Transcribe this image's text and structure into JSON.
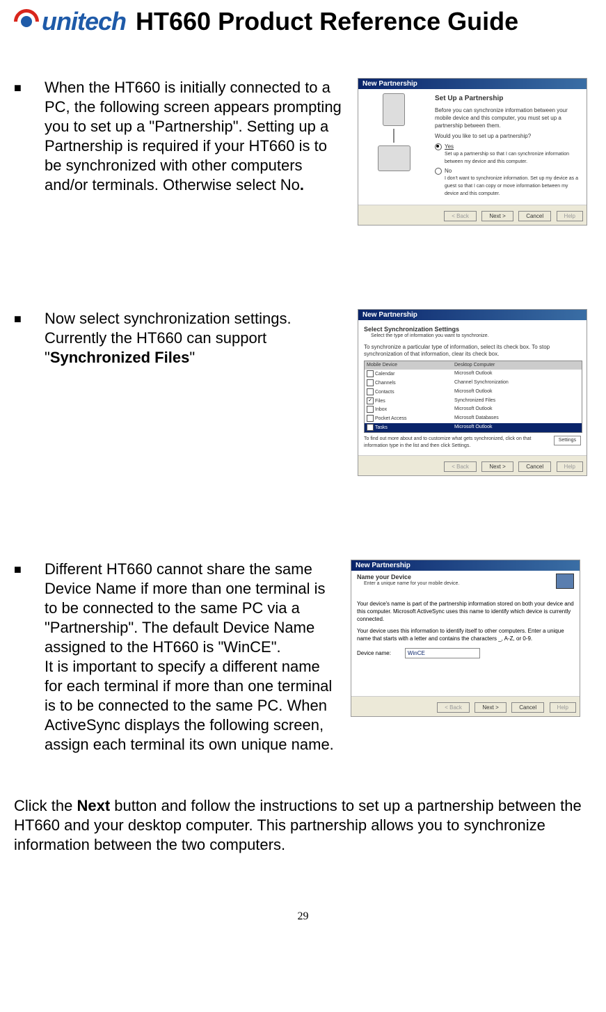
{
  "header": {
    "logo_text": "unitech",
    "title": "HT660 Product Reference Guide"
  },
  "sections": {
    "s1": {
      "text": "When the HT660 is initially connected to a PC, the following screen appears prompting you to set up a \"Partnership\". Setting up a Partnership is required if your HT660 is to be synchronized with other computers and/or terminals. Otherwise select No",
      "text_bold_end": "."
    },
    "s2": {
      "prefix": "Now select synchronization settings. Currently the HT660 can support \"",
      "bold": "Synchronized Files",
      "suffix": "\""
    },
    "s3": {
      "text": "Different HT660 cannot share the same Device Name if more than one terminal is to be connected to the same PC via a \"Partnership\". The default Device Name assigned to the HT660 is \"WinCE\".\nIt is important to specify a different name for each terminal if more than one terminal is to be connected to the same PC. When ActiveSync displays the following screen, assign each terminal its own unique name."
    }
  },
  "footer": {
    "prefix": "Click the ",
    "bold": "Next",
    "suffix": " button and follow the instructions to set up a partnership between the HT660 and your desktop computer.   This partnership allows you to synchronize information between the two computers."
  },
  "page_number": "29",
  "screenshot1": {
    "window_title": "New Partnership",
    "heading": "Set Up a Partnership",
    "intro": "Before you can synchronize information between your mobile device and this computer, you must set up a partnership between them.",
    "question": "Would you like to set up a partnership?",
    "opt_yes": "Yes",
    "opt_yes_desc": "Set up a partnership so that I can synchronize information between my device and this computer.",
    "opt_no": "No",
    "opt_no_desc": "I don't want to synchronize information. Set up my device as a guest so that I can copy or move information between my device and this computer.",
    "btn_back": "< Back",
    "btn_next": "Next >",
    "btn_cancel": "Cancel",
    "btn_help": "Help"
  },
  "screenshot2": {
    "window_title": "New Partnership",
    "heading": "Select Synchronization Settings",
    "sub": "Select the type of information you want to synchronize.",
    "desc": "To synchronize a particular type of information, select its check box. To stop synchronization of that information, clear its check box.",
    "col1": "Mobile Device",
    "col2": "Desktop Computer",
    "rows": [
      {
        "cb": false,
        "c1": "Calendar",
        "c2": "Microsoft Outlook"
      },
      {
        "cb": false,
        "c1": "Channels",
        "c2": "Channel Synchronization"
      },
      {
        "cb": false,
        "c1": "Contacts",
        "c2": "Microsoft Outlook"
      },
      {
        "cb": true,
        "c1": "Files",
        "c2": "Synchronized Files"
      },
      {
        "cb": false,
        "c1": "Inbox",
        "c2": "Microsoft Outlook"
      },
      {
        "cb": false,
        "c1": "Pocket Access",
        "c2": "Microsoft Databases"
      },
      {
        "cb": false,
        "c1": "Tasks",
        "c2": "Microsoft Outlook",
        "selected": true
      }
    ],
    "hint": "To find out more about and to customize what gets synchronized, click on that information type in the list and then click Settings.",
    "btn_settings": "Settings",
    "btn_back": "< Back",
    "btn_next": "Next >",
    "btn_cancel": "Cancel",
    "btn_help": "Help"
  },
  "screenshot3": {
    "window_title": "New Partnership",
    "heading": "Name your Device",
    "sub": "Enter a unique name for your mobile device.",
    "desc": "Your device's name is part of the partnership information stored on both your device and this computer. Microsoft ActiveSync uses this name to identify which device is currently connected.",
    "desc2": "Your device uses this information to identify itself to other computers. Enter a unique name that starts with a letter and contains the characters _, A-Z, or 0-9.",
    "label": "Device name:",
    "value": "WinCE",
    "btn_back": "< Back",
    "btn_next": "Next >",
    "btn_cancel": "Cancel",
    "btn_help": "Help"
  }
}
